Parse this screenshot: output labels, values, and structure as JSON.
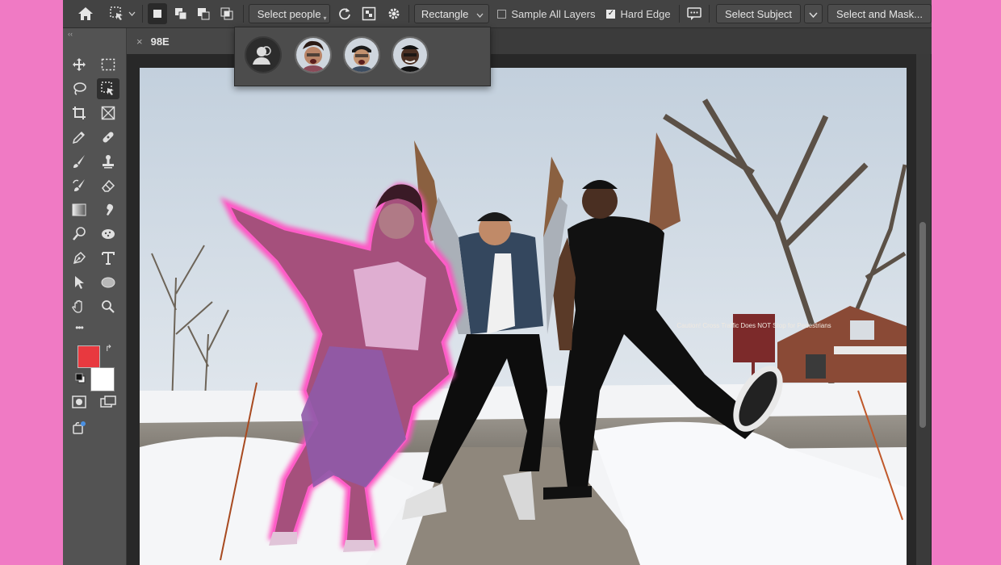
{
  "options_bar": {
    "select_people_label": "Select people",
    "shape_label": "Rectangle",
    "sample_all_layers_label": "Sample All Layers",
    "sample_all_layers_checked": false,
    "hard_edge_label": "Hard Edge",
    "hard_edge_checked": true,
    "select_subject_label": "Select Subject",
    "select_and_mask_label": "Select and Mask..."
  },
  "document_tab": {
    "title": "98E",
    "close_glyph": "×"
  },
  "people_popover": {
    "faces": [
      {
        "name": "woman-with-curly-hair"
      },
      {
        "name": "man-with-cap"
      },
      {
        "name": "man-in-black-shirt"
      }
    ]
  },
  "photo": {
    "sign_text": "Caution! Cross Traffic Does NOT Stop for Pedestrians"
  },
  "colors": {
    "foreground": "#e8393f",
    "background": "#ffffff",
    "selection_highlight": "#ff4fc0",
    "page_background": "#f07ac4"
  },
  "icons": {
    "collapse": "‹‹",
    "more_tools": "•••"
  }
}
